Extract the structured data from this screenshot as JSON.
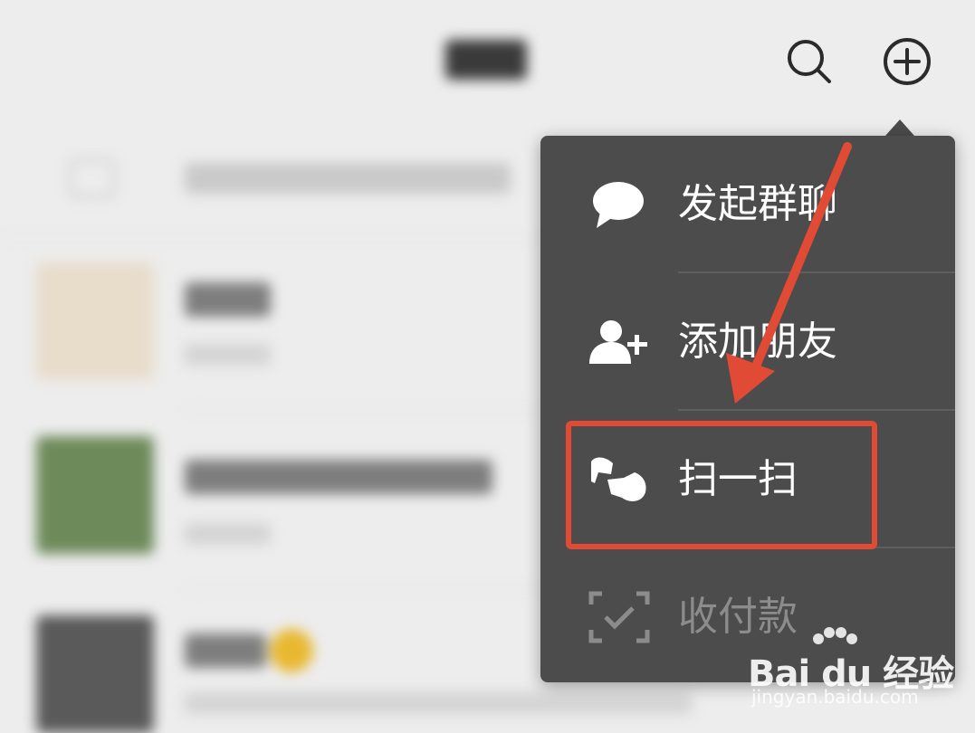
{
  "menu": {
    "items": [
      {
        "label": "发起群聊",
        "icon": "chat-bubble-icon"
      },
      {
        "label": "添加朋友",
        "icon": "add-friend-icon"
      },
      {
        "label": "扫一扫",
        "icon": "scan-icon"
      },
      {
        "label": "收付款",
        "icon": "payment-icon"
      }
    ]
  },
  "header": {
    "search_icon": "search-icon",
    "add_icon": "plus-circle-icon"
  },
  "annotation": {
    "arrow_color": "#e14a34",
    "highlight_color": "#e14a34",
    "highlighted_item": "扫一扫"
  },
  "watermark": {
    "brand": "Bai du 经验",
    "url": "jingyan.baidu.com"
  }
}
